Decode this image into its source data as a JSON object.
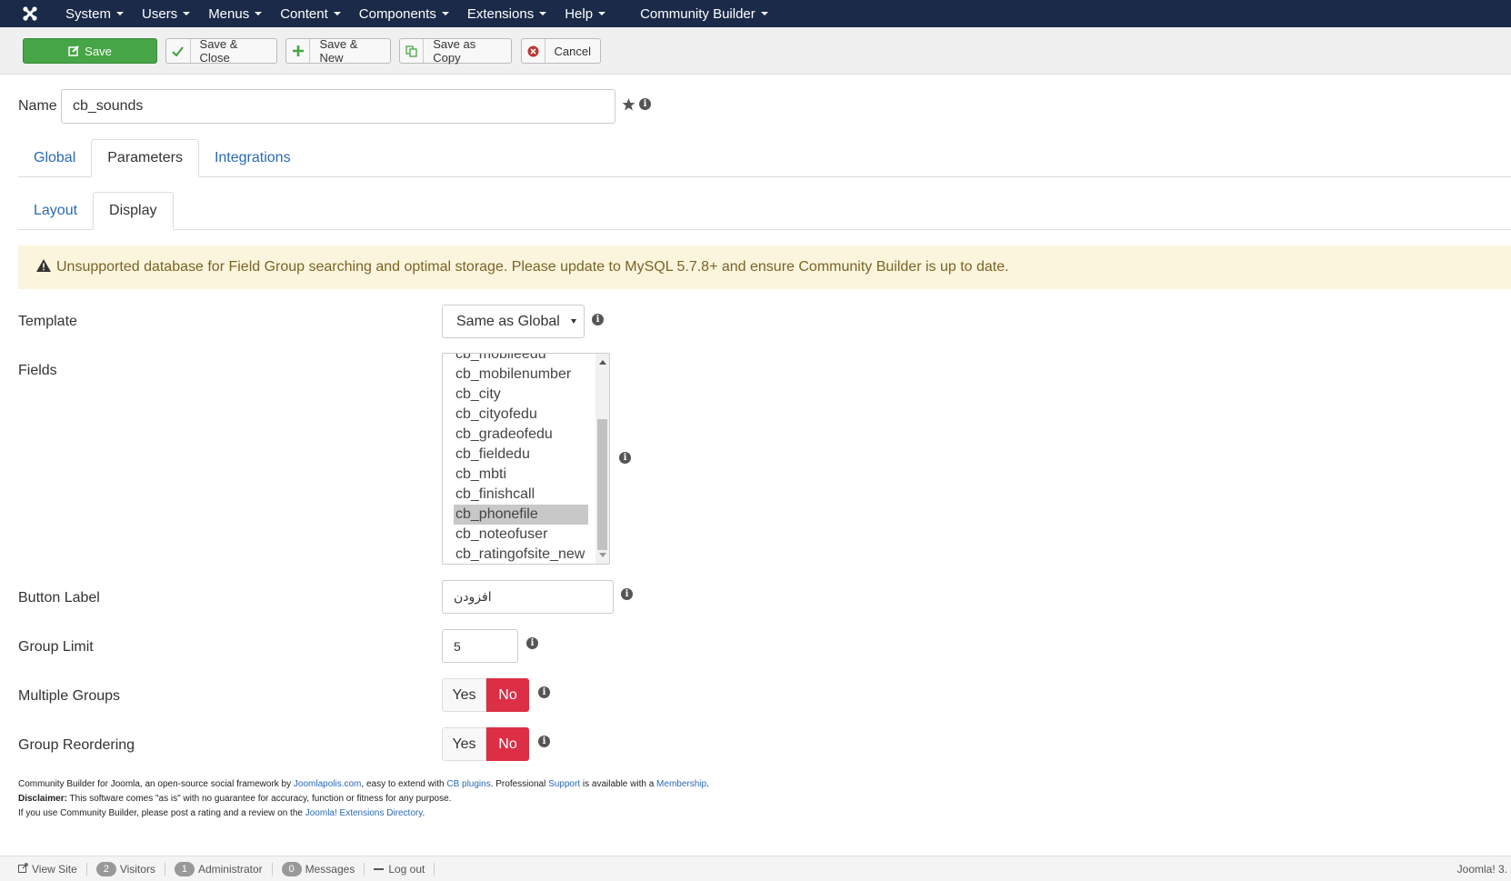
{
  "nav": {
    "logo_icon": "joomla-logo-icon",
    "items": [
      "System",
      "Users",
      "Menus",
      "Content",
      "Components",
      "Extensions",
      "Help"
    ],
    "community_builder": "Community Builder"
  },
  "toolbar": {
    "save": "Save",
    "save_close": "Save & Close",
    "save_new": "Save & New",
    "save_copy": "Save as Copy",
    "cancel": "Cancel"
  },
  "name": {
    "label": "Name",
    "value": "cb_sounds"
  },
  "tabs": {
    "main": [
      "Global",
      "Parameters",
      "Integrations"
    ],
    "main_active": "Parameters",
    "sub": [
      "Layout",
      "Display"
    ],
    "sub_active": "Display"
  },
  "alert": {
    "text": "Unsupported database for Field Group searching and optimal storage. Please update to MySQL 5.7.8+ and ensure Community Builder is up to date."
  },
  "form": {
    "template": {
      "label": "Template",
      "value": "Same as Global"
    },
    "fields": {
      "label": "Fields",
      "options": [
        "cb_mobileedu",
        "cb_mobilenumber",
        "cb_city",
        "cb_cityofedu",
        "cb_gradeofedu",
        "cb_fieldedu",
        "cb_mbti",
        "cb_finishcall",
        "cb_phonefile",
        "cb_noteofuser",
        "cb_ratingofsite_new"
      ],
      "selected": "cb_phonefile"
    },
    "button_label": {
      "label": "Button Label",
      "value": "افزودن"
    },
    "group_limit": {
      "label": "Group Limit",
      "value": "5"
    },
    "multiple_groups": {
      "label": "Multiple Groups",
      "yes": "Yes",
      "no": "No"
    },
    "group_reordering": {
      "label": "Group Reordering",
      "yes": "Yes",
      "no": "No"
    }
  },
  "credits": {
    "line1_a": "Community Builder for Joomla, an open-source social framework by ",
    "link_joomlapolis": "Joomlapolis.com",
    "line1_b": ", easy to extend with ",
    "link_plugins": "CB plugins",
    "line1_c": ". Professional ",
    "link_support": "Support",
    "line1_d": " is available with a ",
    "link_membership": "Membership",
    "line1_e": ".",
    "disclaimer_label": "Disclaimer:",
    "disclaimer_text": " This software comes \"as is\" with no guarantee for accuracy, function or fitness for any purpose.",
    "line3_a": "If you use Community Builder, please post a rating and a review on the ",
    "link_jed": "Joomla! Extensions Directory",
    "line3_b": "."
  },
  "statusbar": {
    "view_site": "View Site",
    "visitors_count": "2",
    "visitors": "Visitors",
    "admin_count": "1",
    "admin": "Administrator",
    "messages_count": "0",
    "messages": "Messages",
    "logout": "Log out",
    "version": "Joomla! 3."
  },
  "colors": {
    "navbar": "#1a2a48",
    "save_green": "#46a546",
    "no_red": "#dc2f45",
    "alert_bg": "#fcf5dd",
    "link": "#2a69b8"
  }
}
